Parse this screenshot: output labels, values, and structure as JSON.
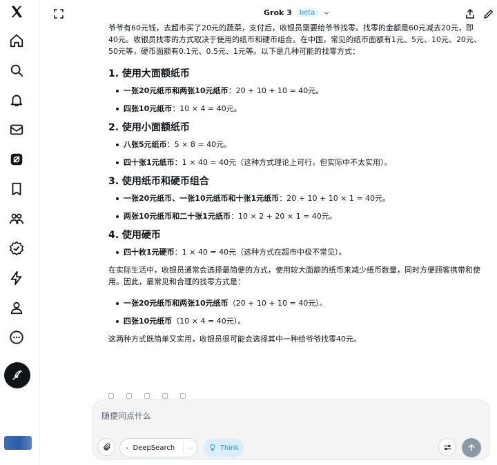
{
  "header": {
    "title": "Grok 3",
    "badge": "beta"
  },
  "sidebar": {
    "icons": [
      "x-logo-icon",
      "home-icon",
      "search-icon",
      "notifications-icon",
      "messages-icon",
      "grok-icon",
      "bookmarks-icon",
      "communities-icon",
      "verified-icon",
      "lightning-icon",
      "profile-icon",
      "more-icon"
    ]
  },
  "content": {
    "intro": "爷爷有60元钱，去超市买了20元的蔬菜，支付后，收银员需要给爷爷找零。找零的金额是60元减去20元，即40元。收银员找零的方式取决于使用的纸币和硬币组合。在中国，常见的纸币面额有1元、5元、10元、20元、50元等，硬币面额有0.1元、0.5元、1元等。以下是几种可能的找零方式：",
    "sections": [
      {
        "heading": "1. 使用大面额纸币",
        "items": [
          {
            "bold": "一张20元纸币和两张10元纸币",
            "text": "：20 + 10 + 10 = 40元。"
          },
          {
            "bold": "四张10元纸币",
            "text": "：10 × 4 = 40元。"
          }
        ]
      },
      {
        "heading": "2. 使用小面额纸币",
        "items": [
          {
            "bold": "八张5元纸币",
            "text": "：5 × 8 = 40元。"
          },
          {
            "bold": "四十张1元纸币",
            "text": "：1 × 40 = 40元（这种方式理论上可行，但实际中不太实用）。"
          }
        ]
      },
      {
        "heading": "3. 使用纸币和硬币组合",
        "items": [
          {
            "bold": "一张20元纸币、一张10元纸币和十张1元纸币",
            "text": "：20 + 10 + 10 × 1 = 40元。"
          },
          {
            "bold": "两张10元纸币和二十张1元纸币",
            "text": "：10 × 2 + 20 × 1 = 40元。"
          }
        ]
      },
      {
        "heading": "4. 使用硬币",
        "items": [
          {
            "bold": "四十枚1元硬币",
            "text": "：1 × 40 = 40元（这种方式在超市中极不常见）。"
          }
        ]
      }
    ],
    "summary": "在实际生活中，收银员通常会选择最简便的方式，使用较大面额的纸币来减少纸币数量，同时方便顾客携带和使用。因此，最常见和合理的找零方式是：",
    "summary_items": [
      {
        "bold": "一张20元纸币和两张10元纸币",
        "text": "（20 + 10 + 10 = 40元）。"
      },
      {
        "bold": "四张10元纸币",
        "text": "（10 × 4 = 40元）。"
      }
    ],
    "conclusion": "这两种方式既简单又实用，收银员很可能会选择其中一种给爷爷找零40元。"
  },
  "composer": {
    "placeholder": "随便问点什么",
    "deepsearch_label": "DeepSearch",
    "think_label": "Think"
  },
  "colors": {
    "accent": "#1d9bf0",
    "text": "#0f1419",
    "muted": "#536471"
  }
}
